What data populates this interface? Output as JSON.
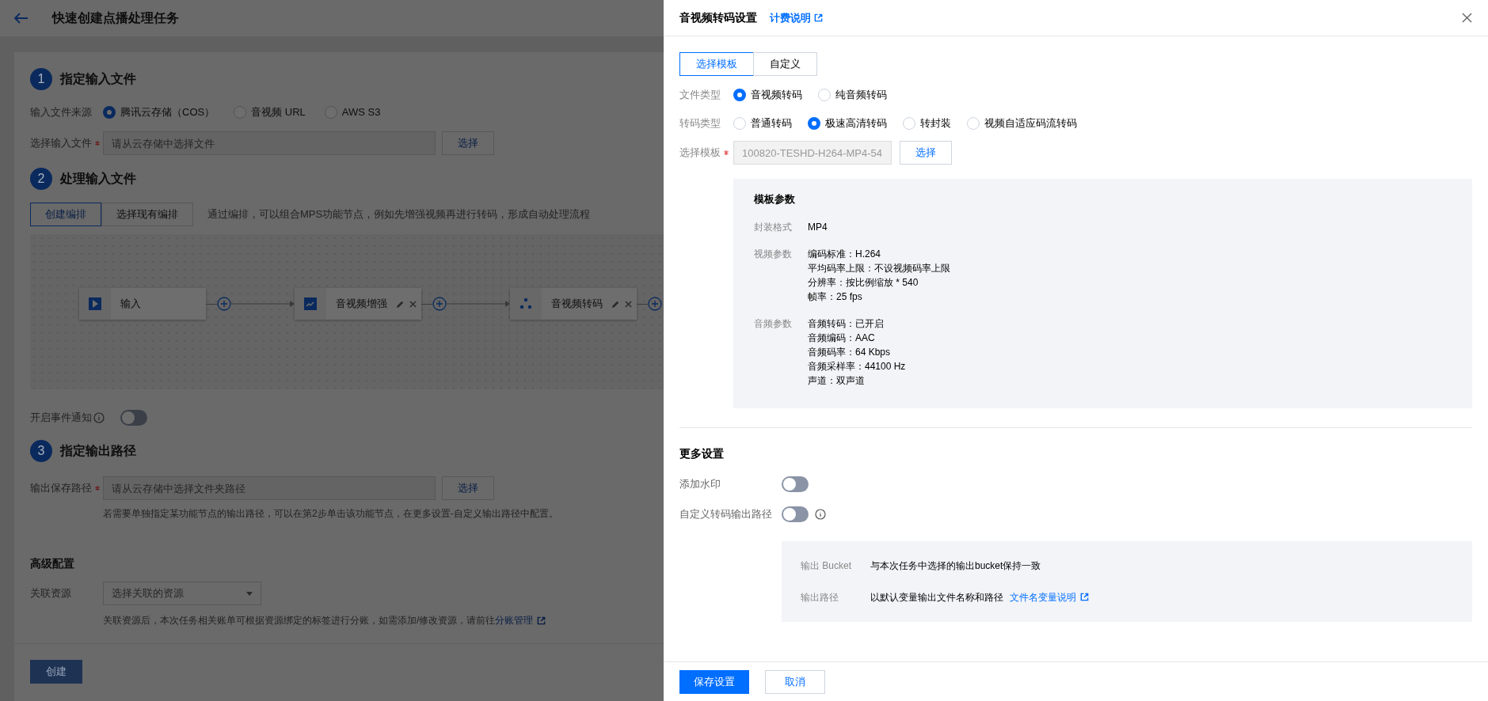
{
  "page": {
    "title": "快速创建点播处理任务",
    "step1": {
      "number": "1",
      "title": "指定输入文件",
      "source_label": "输入文件来源",
      "sources": [
        {
          "label": "腾讯云存储（COS）",
          "selected": true
        },
        {
          "label": "音视频 URL",
          "selected": false
        },
        {
          "label": "AWS S3",
          "selected": false
        }
      ],
      "file_label": "选择输入文件",
      "file_required": true,
      "file_placeholder": "请从云存储中选择文件",
      "select_button": "选择"
    },
    "step2": {
      "number": "2",
      "title": "处理输入文件",
      "tabs": [
        {
          "label": "创建编排",
          "selected": true
        },
        {
          "label": "选择现有编排",
          "selected": false
        }
      ],
      "hint": "通过编排，可以组合MPS功能节点，例如先增强视频再进行转码，形成自动处理流程",
      "nodes": [
        {
          "label": "输入",
          "kind": "input",
          "editable": false
        },
        {
          "label": "音视频增强",
          "kind": "enhance",
          "editable": true
        },
        {
          "label": "音视频转码",
          "kind": "transcode",
          "editable": true
        }
      ],
      "notify_label": "开启事件通知",
      "notify_on": false
    },
    "step3": {
      "number": "3",
      "title": "指定输出路径",
      "path_label": "输出保存路径",
      "path_required": true,
      "path_placeholder": "请从云存储中选择文件夹路径",
      "select_button": "选择",
      "hint": "若需要单独指定某功能节点的输出路径，可以在第2步单击该功能节点，在更多设置-自定义输出路径中配置。"
    },
    "advanced": {
      "title": "高级配置",
      "resource_label": "关联资源",
      "resource_placeholder": "选择关联的资源",
      "hint": "关联资源后，本次任务相关账单可根据资源绑定的标签进行分账，如需添加/修改资源，请前往",
      "hint_link": "分账管理"
    },
    "create_button": "创建"
  },
  "drawer": {
    "title": "音视频转码设置",
    "title_link": "计费说明",
    "tabs": [
      {
        "label": "选择模板",
        "selected": true
      },
      {
        "label": "自定义",
        "selected": false
      }
    ],
    "file_type": {
      "label": "文件类型",
      "options": [
        {
          "label": "音视频转码",
          "selected": true
        },
        {
          "label": "纯音频转码",
          "selected": false
        }
      ]
    },
    "transcode_type": {
      "label": "转码类型",
      "options": [
        {
          "label": "普通转码",
          "selected": false
        },
        {
          "label": "极速高清转码",
          "selected": true
        },
        {
          "label": "转封装",
          "selected": false
        },
        {
          "label": "视频自适应码流转码",
          "selected": false
        }
      ]
    },
    "template": {
      "label": "选择模板",
      "required": true,
      "disabled": true,
      "value": "100820-TESHD-H264-MP4-54",
      "button": "选择"
    },
    "params": {
      "title": "模板参数",
      "groups": [
        {
          "label": "封装格式",
          "lines": [
            "MP4"
          ]
        },
        {
          "label": "视频参数",
          "lines": [
            "编码标准：H.264",
            "平均码率上限：不设视频码率上限",
            "分辨率：按比例缩放 * 540",
            "帧率：25 fps"
          ]
        },
        {
          "label": "音频参数",
          "lines": [
            "音频转码：已开启",
            "音频编码：AAC",
            "音频码率：64 Kbps",
            "音频采样率：44100 Hz",
            "声道：双声道"
          ]
        }
      ]
    },
    "more_title": "更多设置",
    "switches": [
      {
        "label": "添加水印",
        "on": false,
        "info": false
      },
      {
        "label": "自定义转码输出路径",
        "on": false,
        "info": true
      }
    ],
    "output": {
      "rows": [
        {
          "label": "输出 Bucket",
          "value": "与本次任务中选择的输出bucket保持一致"
        },
        {
          "label": "输出路径",
          "value": "以默认变量输出文件名称和路径",
          "link": "文件名变量说明"
        }
      ]
    },
    "save_button": "保存设置",
    "cancel_button": "取消"
  }
}
